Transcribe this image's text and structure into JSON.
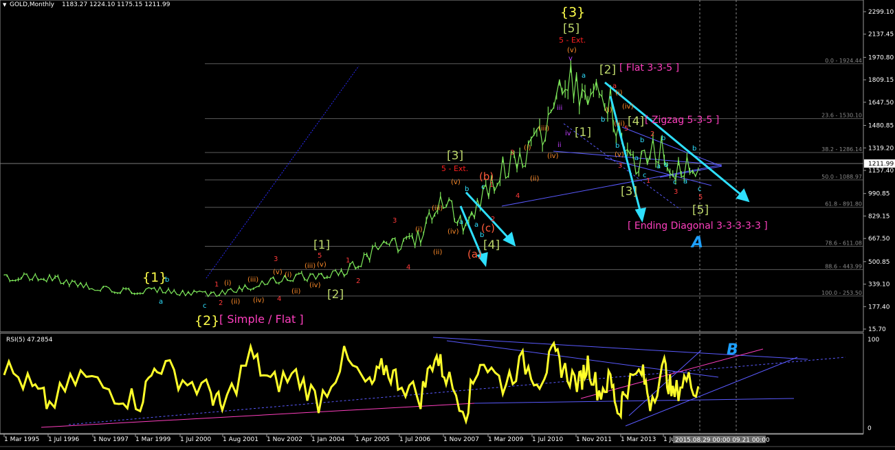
{
  "header": {
    "symbol": "GOLD,Monthly",
    "ohlc": "1183.27 1224.10 1175.15 1211.99"
  },
  "rsi_header": "RSI(5) 47.2854",
  "time_readout": "2015.08.29 00:00  09.21 00:00",
  "colors": {
    "background": "#000000",
    "price": "#7ee85a",
    "rsi": "#ffff2a",
    "arrow": "#2ee0ff",
    "trend": "#5a5aff",
    "magenta": "#ff3fbf",
    "fibo": "#6c6c6c"
  },
  "price_axis": [
    "2299.10",
    "2137.45",
    "1970.80",
    "1809.15",
    "1647.50",
    "1480.85",
    "1319.20",
    "1157.40",
    "990.85",
    "829.15",
    "667.50",
    "500.85",
    "339.10",
    "177.40",
    "15.70"
  ],
  "price_current": "1211.99",
  "rsi_axis": [
    "100",
    "0"
  ],
  "date_axis": [
    "1 Mar 1995",
    "1 Jul 1996",
    "1 Nov 1997",
    "1 Mar 1999",
    "1 Jul 2000",
    "1 Aug 2001",
    "1 Nov 2002",
    "1 Jan 2004",
    "1 Apr 2005",
    "1 Jul 2006",
    "1 Nov 2007",
    "1 Mar 2009",
    "1 Jul 2010",
    "1 Nov 2011",
    "1 Mar 2013",
    "1 Jul"
  ],
  "fibo": [
    "0.0 - 1924.44",
    "23.6 - 1530.10",
    "38.2 - 1286.14",
    "50.0 - 1088.97",
    "61.8 - 891.80",
    "78.6 - 611.08",
    "88.6 - 443.99",
    "100.0 - 253.50"
  ],
  "labels": {
    "w1": "{1}",
    "w2": "{2}",
    "w3": "{3}",
    "simple_flat": "[ Simple / Flat ]",
    "flat335": "[ Flat 3-3-5 ]",
    "zigzag": "[ Zigzag 5-3-5 ]",
    "ending": "[ Ending Diagonal 3-3-3-3-3 ]",
    "ext5": "5 - Ext.",
    "ext5b": "5 - Ext.",
    "b1": "[1]",
    "b2": "[2]",
    "b3": "[3]",
    "b4": "[4]",
    "b5": "[5]",
    "g1": "[1]",
    "g2": "[2]",
    "g3": "[3]",
    "g4": "[4]",
    "g5": "[5]",
    "cA": "A",
    "cB": "B"
  },
  "chart_data": {
    "type": "line",
    "title": "GOLD,Monthly",
    "x_range": [
      "1995-03",
      "2015-09"
    ],
    "ylim": [
      15.7,
      2299.1
    ],
    "grid": false,
    "series": [
      {
        "name": "GOLD,Monthly",
        "x": [
          "1995-03",
          "1996-01",
          "1996-07",
          "1997-06",
          "1998-06",
          "1999-03",
          "1999-09",
          "2000-06",
          "2001-04",
          "2001-08",
          "2002-06",
          "2003-01",
          "2003-10",
          "2004-06",
          "2005-03",
          "2005-12",
          "2006-05",
          "2006-10",
          "2007-06",
          "2007-11",
          "2008-03",
          "2008-10",
          "2009-03",
          "2009-11",
          "2010-06",
          "2010-12",
          "2011-05",
          "2011-09",
          "2012-02",
          "2012-05",
          "2012-09",
          "2013-01",
          "2013-04",
          "2013-06",
          "2013-12",
          "2014-03",
          "2014-08",
          "2014-11",
          "2015-03",
          "2015-08"
        ],
        "values": [
          385,
          395,
          385,
          330,
          295,
          285,
          300,
          275,
          265,
          275,
          320,
          360,
          390,
          395,
          430,
          540,
          675,
          610,
          680,
          900,
          940,
          730,
          925,
          1180,
          1240,
          1390,
          1530,
          1860,
          1700,
          1560,
          1780,
          1660,
          1430,
          1230,
          1210,
          1330,
          1300,
          1170,
          1180,
          1212
        ]
      },
      {
        "name": "RSI(5)",
        "ylim": [
          0,
          100
        ],
        "values": [
          70,
          45,
          25,
          60,
          40,
          30,
          75,
          55,
          40,
          20,
          85,
          50,
          60,
          30,
          80,
          45,
          70,
          55,
          35,
          85,
          60,
          20,
          80,
          50,
          75,
          55,
          85,
          65,
          50,
          75,
          40,
          55,
          15,
          45,
          65,
          30,
          70,
          35,
          55,
          47.2854
        ]
      }
    ]
  }
}
